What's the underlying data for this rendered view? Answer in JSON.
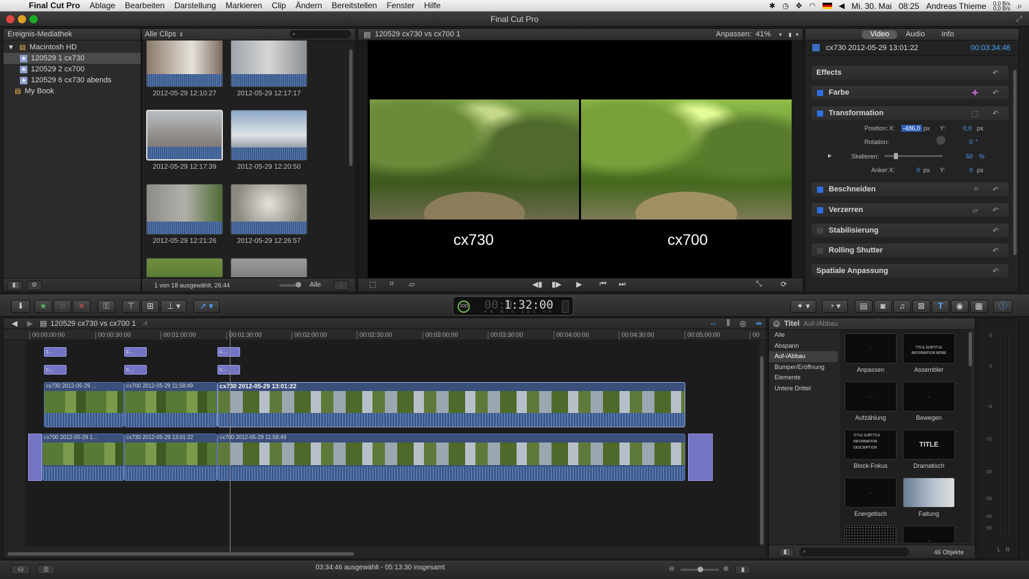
{
  "menubar": {
    "app": "Final Cut Pro",
    "items": [
      "Ablage",
      "Bearbeiten",
      "Darstellung",
      "Markieren",
      "Clip",
      "Ändern",
      "Bereitstellen",
      "Fenster",
      "Hilfe"
    ],
    "date": "Mi. 30. Mai",
    "time": "08:25",
    "user": "Andreas Thieme",
    "net_up": "0,0 B/s",
    "net_down": "0,0 B/s"
  },
  "window": {
    "title": "Final Cut Pro"
  },
  "library": {
    "header": "Ereignis-Mediathek",
    "items": [
      {
        "label": "Macintosh HD",
        "kind": "drive"
      },
      {
        "label": "120529 1 cx730",
        "kind": "event",
        "selected": true
      },
      {
        "label": "120529 2 cx700",
        "kind": "event"
      },
      {
        "label": "120529 6 cx730 abends",
        "kind": "event"
      },
      {
        "label": "My Book",
        "kind": "drive"
      }
    ]
  },
  "browser": {
    "filter_label": "Alle Clips",
    "clips": [
      {
        "caption": "2012-05-29 12:10:27"
      },
      {
        "caption": "2012-05-29 12:17:17"
      },
      {
        "caption": "2012-05-29 12:17:39",
        "selected": true
      },
      {
        "caption": "2012-05-29 12:20:50"
      },
      {
        "caption": "2012-05-29 12:21:26"
      },
      {
        "caption": "2012-05-29 12:26:57"
      }
    ],
    "status": "1 von 18 ausgewählt, 26:44",
    "all_label": "Alle"
  },
  "viewer": {
    "title": "120529 cx730 vs cx700 1",
    "zoom_label": "Anpassen:",
    "zoom_value": "41%",
    "left_label": "cx730",
    "right_label": "cx700"
  },
  "inspector": {
    "tabs": [
      "Video",
      "Audio",
      "Info"
    ],
    "active_tab": "Video",
    "clip_name": "cx730 2012-05-29 13:01:22",
    "duration": "00:03:34:46",
    "sections": {
      "effects": "Effects",
      "farbe": "Farbe",
      "transformation": "Transformation",
      "beschneiden": "Beschneiden",
      "verzerren": "Verzerren",
      "stabilisierung": "Stabilisierung",
      "rolling_shutter": "Rolling Shutter",
      "spatial": "Spatiale Anpassung"
    },
    "transform": {
      "position_label": "Position:",
      "x_label": "X:",
      "y_label": "Y:",
      "pos_x": "-486,0",
      "pos_y": "0,0",
      "unit_px": "px",
      "rotation_label": "Rotation:",
      "rotation": "0",
      "deg": "°",
      "scale_label": "Skalieren:",
      "scale": "50",
      "pct": "%",
      "anchor_label": "Anker:",
      "anchor_x": "0",
      "anchor_y": "0"
    }
  },
  "toolbar": {
    "timecode_dim": "00:0",
    "timecode": "1:32:00",
    "timecode_units": "HR MIN SEC FR",
    "percent": "100"
  },
  "timeline": {
    "project": "120529 cx730 vs cx700 1",
    "ruler": [
      "00:00:00:00",
      "00:00:30:00",
      "00:01:00:00",
      "00:01:30:00",
      "00:02:00:00",
      "00:02:30:00",
      "00:03:00:00",
      "00:03:30:00",
      "00:04:00:00",
      "00:04:30:00",
      "00:05:00:00",
      "00"
    ],
    "title_clip_label": "c...",
    "upper_clips": [
      "cx730 2012-05-29 ...",
      "cx700 2012-05-29 11:58:49",
      "cx730 2012-05-29 13:01:22"
    ],
    "lower_clips": [
      "cx700 2012-05-29 1...",
      "cx730 2012-05-29 13:01:22",
      "cx700 2012-05-29 11:58:49"
    ]
  },
  "effects": {
    "header": "Titel",
    "subheader": "Auf-/Abbau",
    "categories": [
      "Alle",
      "Abspann",
      "Auf-/Abbau",
      "Bumper/Eröffnung",
      "Elemente",
      "Untere Drittel"
    ],
    "selected_category": "Auf-/Abbau",
    "items": [
      "Anpassen",
      "Assembler",
      "Aufzählung",
      "Bewegen",
      "Block-Fokus",
      "Dramatisch",
      "Energetisch",
      "Faltung"
    ],
    "thumb_text": {
      "assembler": "TITLE SUBTITLE INFORMATION MORE",
      "block": "TITLE SUBTITLE INFORMATION DESCRIPTION",
      "dramatisch": "TITLE"
    },
    "count": "46 Objekte"
  },
  "meters": {
    "scale": [
      "6",
      "0",
      "-6",
      "-12",
      "-20",
      "-30",
      "-40",
      "-50"
    ],
    "channels": [
      "L",
      "R"
    ]
  },
  "status": {
    "message": "03:34:46 ausgewählt - 05:13:30 insgesamt"
  }
}
